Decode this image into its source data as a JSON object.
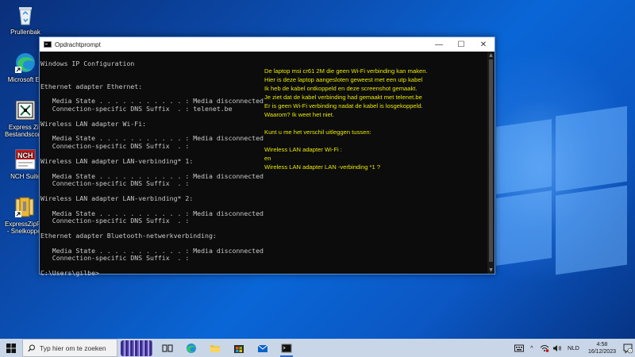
{
  "desktop": {
    "icons": [
      {
        "label": "Prullenbak",
        "icon": "recycle-bin-icon"
      },
      {
        "label": "Microsoft Ed",
        "icon": "edge-icon"
      },
      {
        "label": "Express Zip Bestandscompr",
        "icon": "express-zip-icon"
      },
      {
        "label": "NCH Suite",
        "icon": "nch-suite-icon"
      },
      {
        "label": "ExpressZipFileC - Snelkoppeli",
        "icon": "express-zip-shortcut-icon"
      }
    ]
  },
  "window": {
    "title": "Opdrachtprompt",
    "minimize": "—",
    "maximize": "☐",
    "close": "✕"
  },
  "console": {
    "lines": [
      "",
      "Windows IP Configuration",
      "",
      "",
      "Ethernet adapter Ethernet:",
      "",
      "   Media State . . . . . . . . . . . : Media disconnected",
      "   Connection-specific DNS Suffix  . : telenet.be",
      "",
      "Wireless LAN adapter Wi-Fi:",
      "",
      "   Media State . . . . . . . . . . . : Media disconnected",
      "   Connection-specific DNS Suffix  . :",
      "",
      "Wireless LAN adapter LAN-verbinding* 1:",
      "",
      "   Media State . . . . . . . . . . . : Media disconnected",
      "   Connection-specific DNS Suffix  . :",
      "",
      "Wireless LAN adapter LAN-verbinding* 2:",
      "",
      "   Media State . . . . . . . . . . . : Media disconnected",
      "   Connection-specific DNS Suffix  . :",
      "",
      "Ethernet adapter Bluetooth-netwerkverbinding:",
      "",
      "   Media State . . . . . . . . . . . : Media disconnected",
      "   Connection-specific DNS Suffix  . :",
      "",
      "C:\\Users\\gilbe>"
    ]
  },
  "note": {
    "color": "#e6e600",
    "lines": [
      "De laptop msi cr61 2M die geen Wi-Fi verbinding kan maken.",
      "Hier is deze laptop aangesloten geweest met een utp kabel",
      "Ik heb de kabel ontkoppeld en deze screenshot gemaakt.",
      "Je ziet dat de kabel verbinding had gemaakt met telenet.be",
      "Er is geen Wi-Fi verbinding nadat de kabel is losgekoppeld.",
      "Waarom? Ik weet het niet.",
      "",
      "Kunt u me het verschil uitleggen tussen:",
      "",
      "Wireless LAN adapter  Wi-Fi :",
      "en",
      "Wireless LAN adapter LAN -verbinding *1 ?"
    ]
  },
  "taskbar": {
    "search_placeholder": "Typ hier om te zoeken",
    "apps": [
      "task-view-icon",
      "edge-icon",
      "file-explorer-icon",
      "store-icon",
      "mail-icon",
      "command-prompt-icon"
    ],
    "language": "NLD",
    "time": "4:58",
    "date": "16/12/2023",
    "notification_count": "1"
  }
}
